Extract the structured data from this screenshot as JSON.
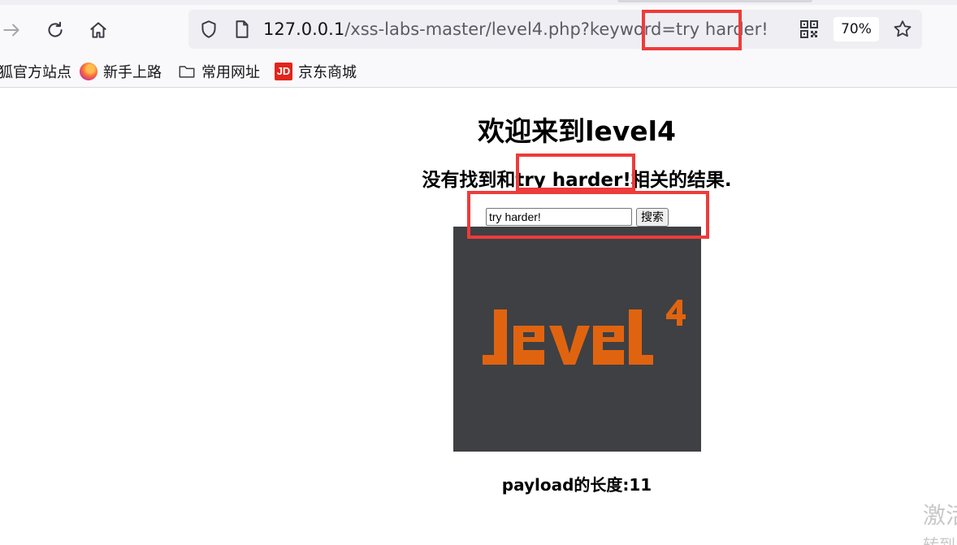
{
  "browser": {
    "url": {
      "host": "127.0.0.1",
      "path": "/xss-labs-master/level4.php?keyword=try harder!"
    },
    "zoom": "70%",
    "icons": {
      "back": "arrow-right-icon",
      "reload": "reload-icon",
      "home": "home-icon",
      "shield": "shield-icon",
      "page": "page-icon",
      "qr": "qr-code-icon",
      "star": "star-icon"
    },
    "bookmarks": [
      {
        "label": "狐官方站点",
        "icon": "none"
      },
      {
        "label": "新手上路",
        "icon": "firefox-icon"
      },
      {
        "label": "常用网址",
        "icon": "folder-icon"
      },
      {
        "label": "京东商城",
        "icon": "jd-icon",
        "icon_text": "JD"
      }
    ]
  },
  "page": {
    "title": "欢迎来到level4",
    "result_message": "没有找到和try harder!相关的结果.",
    "search": {
      "value": "try harder!",
      "button_label": "搜索"
    },
    "image_text": "level4",
    "payload_length": "payload的长度:11"
  },
  "overlay": {
    "watermark_line1": "激活",
    "watermark_line2": "转到"
  },
  "colors": {
    "highlight": "#ee3b3b",
    "image_bg": "#3f4043",
    "image_logo": "#e0640f"
  }
}
